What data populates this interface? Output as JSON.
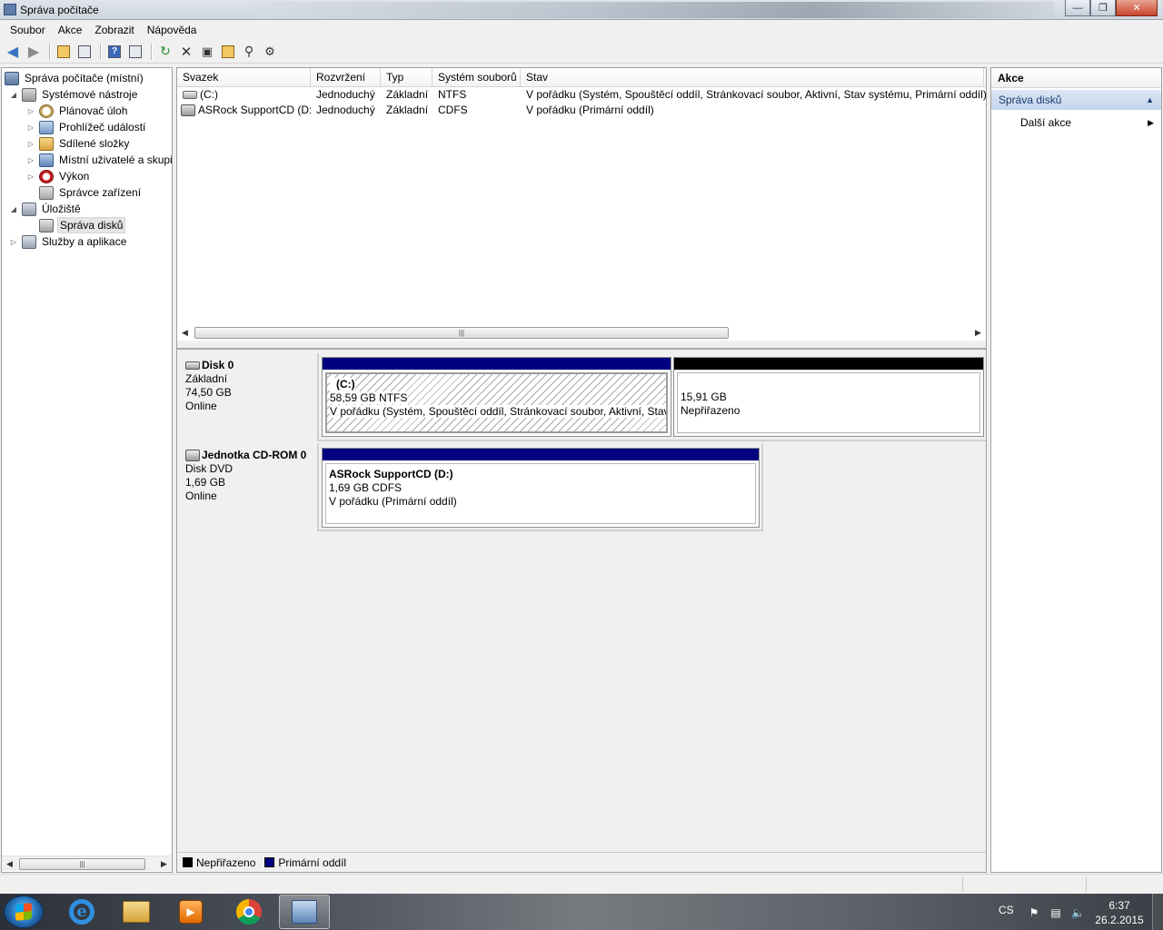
{
  "window": {
    "title": "Správa počítače"
  },
  "menu": [
    "Soubor",
    "Akce",
    "Zobrazit",
    "Nápověda"
  ],
  "toolbar": {
    "icons": [
      "back-arrow-icon",
      "forward-arrow-icon",
      "up-folder-icon",
      "show-hide-tree-icon",
      "help-icon",
      "show-hide-action-pane-icon",
      "refresh-icon",
      "delete-icon",
      "properties-icon",
      "open-folder-icon",
      "search-icon",
      "settings-icon"
    ]
  },
  "tree": {
    "root": "Správa počítače (místní)",
    "system_tools": "Systémové nástroje",
    "task_scheduler": "Plánovač úloh",
    "event_viewer": "Prohlížeč událostí",
    "shared_folders": "Sdílené složky",
    "local_users": "Místní uživatelé a skupiny",
    "performance": "Výkon",
    "device_manager": "Správce zařízení",
    "storage": "Úložiště",
    "disk_management": "Správa disků",
    "services": "Služby a aplikace"
  },
  "volumes": {
    "columns": [
      "Svazek",
      "Rozvržení",
      "Typ",
      "Systém souborů",
      "Stav"
    ],
    "rows": [
      {
        "name": "(C:)",
        "layout": "Jednoduchý",
        "type": "Základní",
        "fs": "NTFS",
        "status": "V pořádku (Systém, Spouštěcí oddíl, Stránkovací soubor, Aktivní, Stav systému, Primární oddíl)"
      },
      {
        "name": "ASRock SupportCD (D:)",
        "layout": "Jednoduchý",
        "type": "Základní",
        "fs": "CDFS",
        "status": "V pořádku (Primární oddíl)"
      }
    ]
  },
  "disks": {
    "disk0": {
      "name": "Disk 0",
      "type": "Základní",
      "size": "74,50 GB",
      "state": "Online",
      "partitions": [
        {
          "label": "(C:)",
          "size": "58,59 GB NTFS",
          "status": "V pořádku (Systém, Spouštěcí oddíl, Stránkovací soubor, Aktivní, Stav systému, Primární oddíl)"
        },
        {
          "label": "",
          "size": "15,91 GB",
          "status": "Nepřiřazeno"
        }
      ]
    },
    "cdrom0": {
      "name": "Jednotka CD-ROM 0",
      "type": "Disk DVD",
      "size": "1,69 GB",
      "state": "Online",
      "partitions": [
        {
          "label": "ASRock SupportCD  (D:)",
          "size": "1,69 GB CDFS",
          "status": "V pořádku (Primární oddíl)"
        }
      ]
    }
  },
  "legend": [
    {
      "label": "Nepřiřazeno",
      "color": "#000000"
    },
    {
      "label": "Primární oddíl",
      "color": "#000080"
    }
  ],
  "actions": {
    "header": "Akce",
    "section": "Správa disků",
    "more": "Další akce"
  },
  "taskbar": {
    "apps": [
      "internet-explorer-icon",
      "file-explorer-icon",
      "media-player-icon",
      "chrome-icon",
      "computer-management-icon"
    ],
    "language": "CS",
    "time": "6:37",
    "date": "26.2.2015"
  },
  "colors": {
    "primary_partition": "#000080",
    "unallocated": "#000000",
    "action_section_bg": "#c4d5ec"
  }
}
